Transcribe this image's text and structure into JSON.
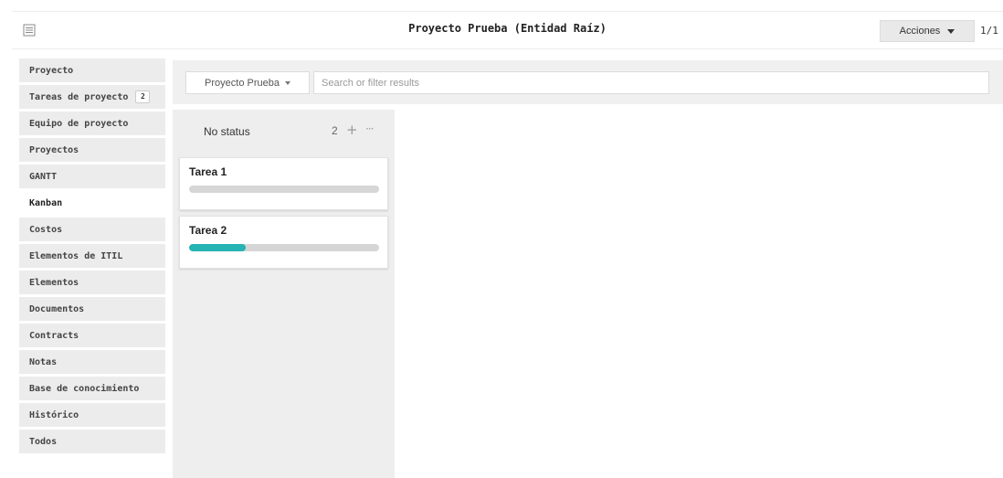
{
  "header": {
    "title": "Proyecto Prueba (Entidad Raíz)",
    "menu_icon": "list-icon",
    "actions_label": "Acciones",
    "pager": "1/1"
  },
  "sidebar": {
    "items": [
      {
        "label": "Proyecto"
      },
      {
        "label": "Tareas de proyecto",
        "badge": "2"
      },
      {
        "label": "Equipo de proyecto"
      },
      {
        "label": "Proyectos"
      },
      {
        "label": "GANTT"
      },
      {
        "label": "Kanban",
        "active": true
      },
      {
        "label": "Costos"
      },
      {
        "label": "Elementos de ITIL"
      },
      {
        "label": "Elementos"
      },
      {
        "label": "Documentos"
      },
      {
        "label": "Contracts"
      },
      {
        "label": "Notas"
      },
      {
        "label": "Base de conocimiento"
      },
      {
        "label": "Histórico"
      },
      {
        "label": "Todos"
      }
    ]
  },
  "filter": {
    "project_label": "Proyecto Prueba",
    "search_placeholder": "Search or filter results"
  },
  "kanban": {
    "column": {
      "title": "No status",
      "count": "2",
      "add_symbol": "+",
      "more_symbol": "···"
    },
    "cards": [
      {
        "title": "Tarea 1",
        "progress": 0
      },
      {
        "title": "Tarea 2",
        "progress": 0.3
      }
    ],
    "progress_color": "#25b3b3"
  }
}
